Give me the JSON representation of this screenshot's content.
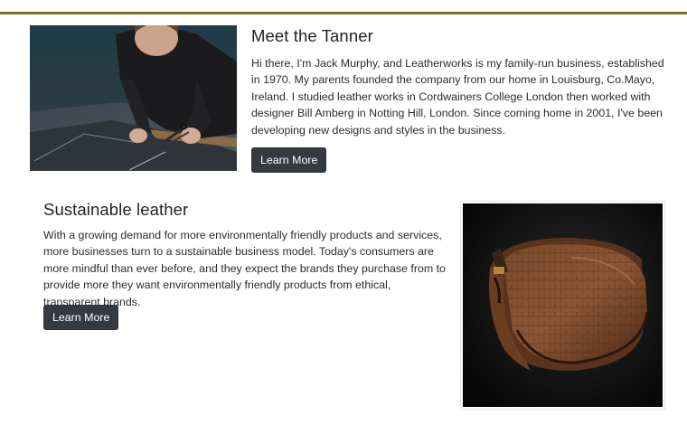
{
  "tanner": {
    "title": "Meet the Tanner",
    "body": "Hi there, I'm Jack Murphy, and Leatherworks is my family-run business, established in 1970. My parents founded the company from our home in Louisburg, Co.Mayo, Ireland. I studied leather works in Cordwainers College London then worked with designer Bill Amberg in Notting Hill, London. Since coming home in 2001, I've been developing new designs and styles in the business.",
    "button_label": "Learn More",
    "image_icon": "craftsman-cutting-leather-photo"
  },
  "sustainable": {
    "title": "Sustainable leather",
    "body": "With a growing demand for more environmentally friendly products and services, more businesses turn to a sustainable business model. Today's consumers are more mindful than ever before, and they expect the brands they purchase from to provide more they want environmentally friendly products from ethical, transparent brands.",
    "button_label": "Learn More",
    "image_icon": "brown-leather-saddle-bag-photo"
  },
  "colors": {
    "accent_rule": "#8c7a2e",
    "button_bg": "#343a40",
    "button_text": "#ffffff",
    "text": "#212529"
  }
}
